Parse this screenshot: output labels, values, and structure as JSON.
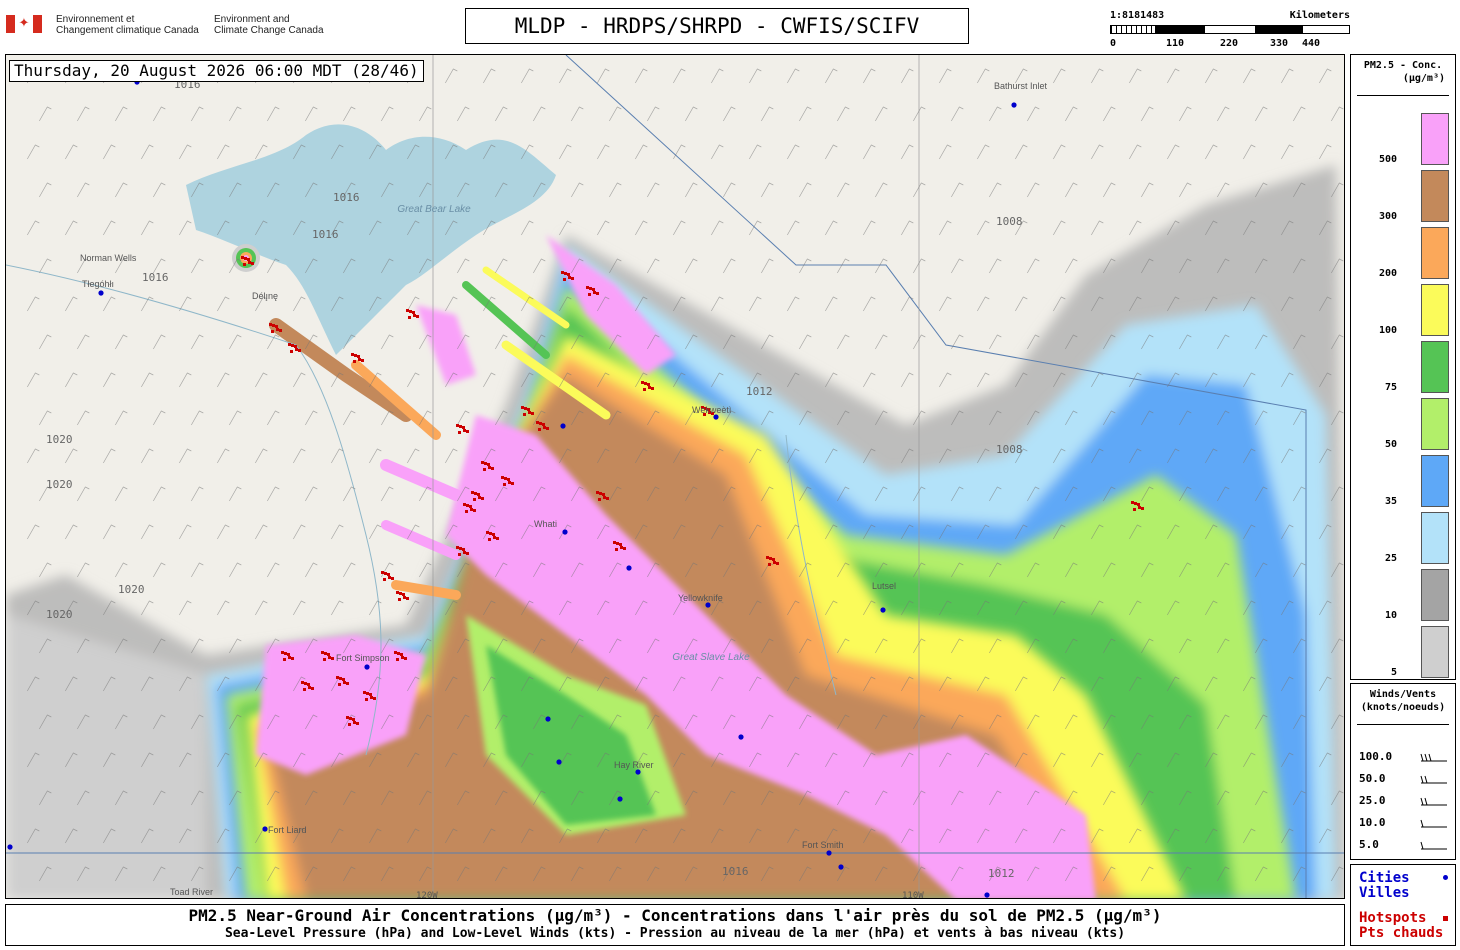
{
  "header": {
    "dept_fr": [
      "Environnement et",
      "Changement climatique Canada"
    ],
    "dept_en": [
      "Environment and",
      "Climate Change Canada"
    ],
    "title": "MLDP - HRDPS/SHRPD - CWFIS/SCIFV"
  },
  "scale": {
    "ratio": "1:8181483",
    "unit": "Kilometers",
    "ticks": [
      "0",
      "110",
      "220",
      "330",
      "440"
    ]
  },
  "map": {
    "datetime_label": "Thursday, 20 August 2026 06:00 MDT (28/46)",
    "lakes": [
      "Great Bear Lake",
      "Great Slave Lake"
    ],
    "places": [
      "Bathurst Inlet",
      "Norman Wells",
      "Tłegóhłı",
      "Wekweètì",
      "Whati",
      "Yellowknife",
      "Lutsel",
      "Hay River",
      "Fort Smith",
      "Fort Liard",
      "Fort Simpson",
      "Délı̨nę",
      "Toad River"
    ],
    "isobars": [
      "1016",
      "1016",
      "1016",
      "1016",
      "1020",
      "1020",
      "1020",
      "1020",
      "1012",
      "1008",
      "1008",
      "1016",
      "1012"
    ],
    "meridians": [
      "120W",
      "110W"
    ],
    "colors": {
      "land": "#f1efe9",
      "water": "#aed3df",
      "hotspot": "#cc0000",
      "city": "#0000cc"
    }
  },
  "legend_pm": {
    "title": [
      "PM2.5 - Conc.",
      "(µg/m³)"
    ],
    "levels": [
      {
        "value": "500",
        "color": "#f9a1f9"
      },
      {
        "value": "300",
        "color": "#c3895b"
      },
      {
        "value": "200",
        "color": "#fba85a"
      },
      {
        "value": "100",
        "color": "#fbfb5a"
      },
      {
        "value": "75",
        "color": "#55c455"
      },
      {
        "value": "50",
        "color": "#b2ef6a"
      },
      {
        "value": "35",
        "color": "#5ea8f7"
      },
      {
        "value": "25",
        "color": "#b3e2f9"
      },
      {
        "value": "10",
        "color": "#a4a4a4"
      },
      {
        "value": "5",
        "color": "#cfcfcf"
      }
    ]
  },
  "legend_wind": {
    "title": [
      "Winds/Vents",
      "(knots/noeuds)"
    ],
    "speeds": [
      "100.0",
      "50.0",
      "25.0",
      "10.0",
      "5.0"
    ]
  },
  "legend_points": {
    "cities": [
      "Cities",
      "Villes"
    ],
    "hotspots": [
      "Hotspots",
      "Pts chauds"
    ]
  },
  "footer": {
    "line1": "PM2.5 Near-Ground Air Concentrations (µg/m³) - Concentrations dans l'air près du sol de PM2.5 (µg/m³)",
    "line2": "Sea-Level Pressure (hPa) and Low-Level Winds (kts) - Pression au niveau de la mer (hPa) et vents à bas niveau (kts)"
  }
}
